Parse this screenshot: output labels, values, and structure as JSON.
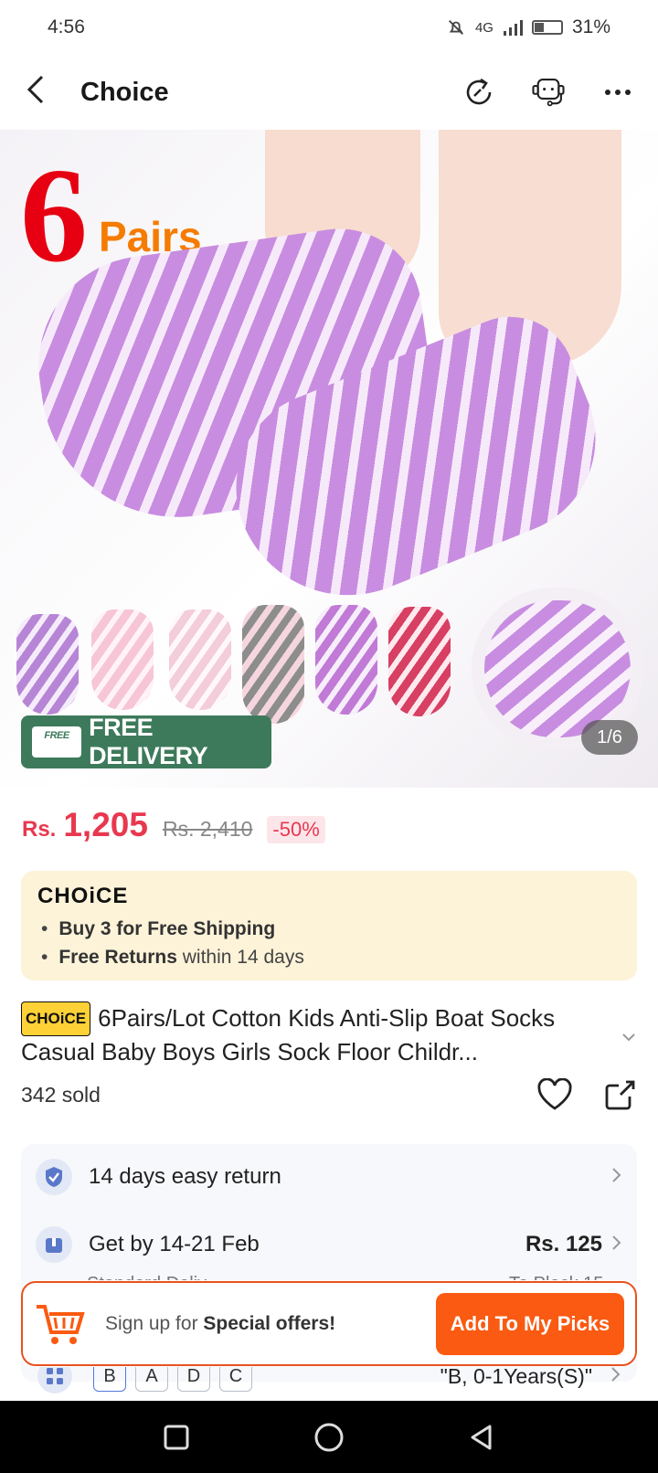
{
  "status": {
    "time": "4:56",
    "network": "4G",
    "battery": "31%"
  },
  "nav": {
    "title": "Choice"
  },
  "hero": {
    "six": "6",
    "pairs": "Pairs",
    "free_delivery_truck": "FREE",
    "free_delivery": "FREE DELIVERY",
    "counter": "1/6"
  },
  "price": {
    "currency": "Rs.",
    "current": "1,205",
    "original": "Rs. 2,410",
    "discount": "-50%"
  },
  "choice": {
    "logo": "CHOiCE",
    "line1_bold": "Buy 3 for  Free Shipping",
    "line2_bold": "Free Returns",
    "line2_rest": " within 14 days"
  },
  "product": {
    "tag": "CHOiCE",
    "title": "6Pairs/Lot Cotton Kids Anti-Slip Boat Socks Casual Baby Boys Girls Sock Floor Childr...",
    "sold": "342 sold"
  },
  "services": {
    "return_text": "14 days easy return",
    "delivery_text": "Get by 14-21 Feb",
    "delivery_price": "Rs. 125",
    "delivery_sub_left": "Standard Deliv",
    "delivery_sub_right": "To Plock 15"
  },
  "variants": {
    "options": [
      "B",
      "A",
      "D",
      "C"
    ],
    "selected_value": "\"B, 0-1Years(S)\""
  },
  "promo": {
    "text_prefix": "Sign up for ",
    "text_bold": "Special offers!",
    "button": "Add To My Picks"
  },
  "colors": {
    "accent": "#fa5a11",
    "price": "#e8384f",
    "badge_green": "#3d7a5b",
    "choice_bg": "#fdf3d9"
  }
}
